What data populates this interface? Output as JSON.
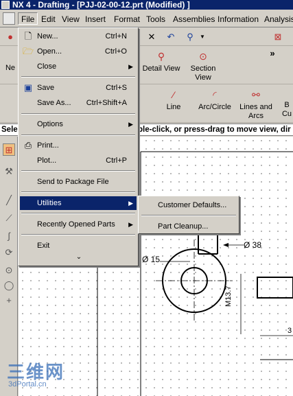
{
  "window": {
    "title": "NX 4 - Drafting - [PJJ-02-00-12.prt (Modified) ]"
  },
  "menubar": [
    {
      "label": "File"
    },
    {
      "label": "Edit"
    },
    {
      "label": "View"
    },
    {
      "label": "Insert"
    },
    {
      "label": "Format"
    },
    {
      "label": "Tools"
    },
    {
      "label": "Assemblies"
    },
    {
      "label": "Information"
    },
    {
      "label": "Analysis"
    }
  ],
  "toolbar2": {
    "left_label": "Ne",
    "detail_view": "Detail View",
    "section_view_1": "Section",
    "section_view_2": "View",
    "more": "»"
  },
  "toolbar3": {
    "line": "Line",
    "arc_circle": "Arc/Circle",
    "lines_arcs_1": "Lines and",
    "lines_arcs_2": "Arcs",
    "b_label": "B",
    "cu_label": "Cu"
  },
  "cue_line": {
    "left": "Sele",
    "right": "ple-click, or press-drag to move view, dir"
  },
  "file_menu": {
    "items": [
      {
        "label": "New...",
        "shortcut": "Ctrl+N"
      },
      {
        "label": "Open...",
        "shortcut": "Ctrl+O"
      },
      {
        "label": "Close",
        "shortcut": ""
      },
      {
        "label": "Save",
        "shortcut": "Ctrl+S"
      },
      {
        "label": "Save As...",
        "shortcut": "Ctrl+Shift+A"
      },
      {
        "label": "Options",
        "shortcut": ""
      },
      {
        "label": "Print...",
        "shortcut": ""
      },
      {
        "label": "Plot...",
        "shortcut": "Ctrl+P"
      },
      {
        "label": "Send to Package File",
        "shortcut": ""
      },
      {
        "label": "Utilities",
        "shortcut": ""
      },
      {
        "label": "Recently Opened Parts",
        "shortcut": ""
      },
      {
        "label": "Exit",
        "shortcut": ""
      }
    ],
    "more": "⌄"
  },
  "utilities_submenu": {
    "items": [
      {
        "label": "Customer Defaults..."
      },
      {
        "label": "Part Cleanup..."
      }
    ]
  },
  "drawing": {
    "dim_15": "Ø 15",
    "dim_38": "Ø 38",
    "dim_m13": "M13.7"
  },
  "watermark": {
    "logo": "三维网",
    "url": "3dPortal.cn"
  },
  "colors": {
    "menu_highlight": "#0a246a",
    "title_bar": "#0a246a",
    "window_bg": "#d4d0c8"
  }
}
